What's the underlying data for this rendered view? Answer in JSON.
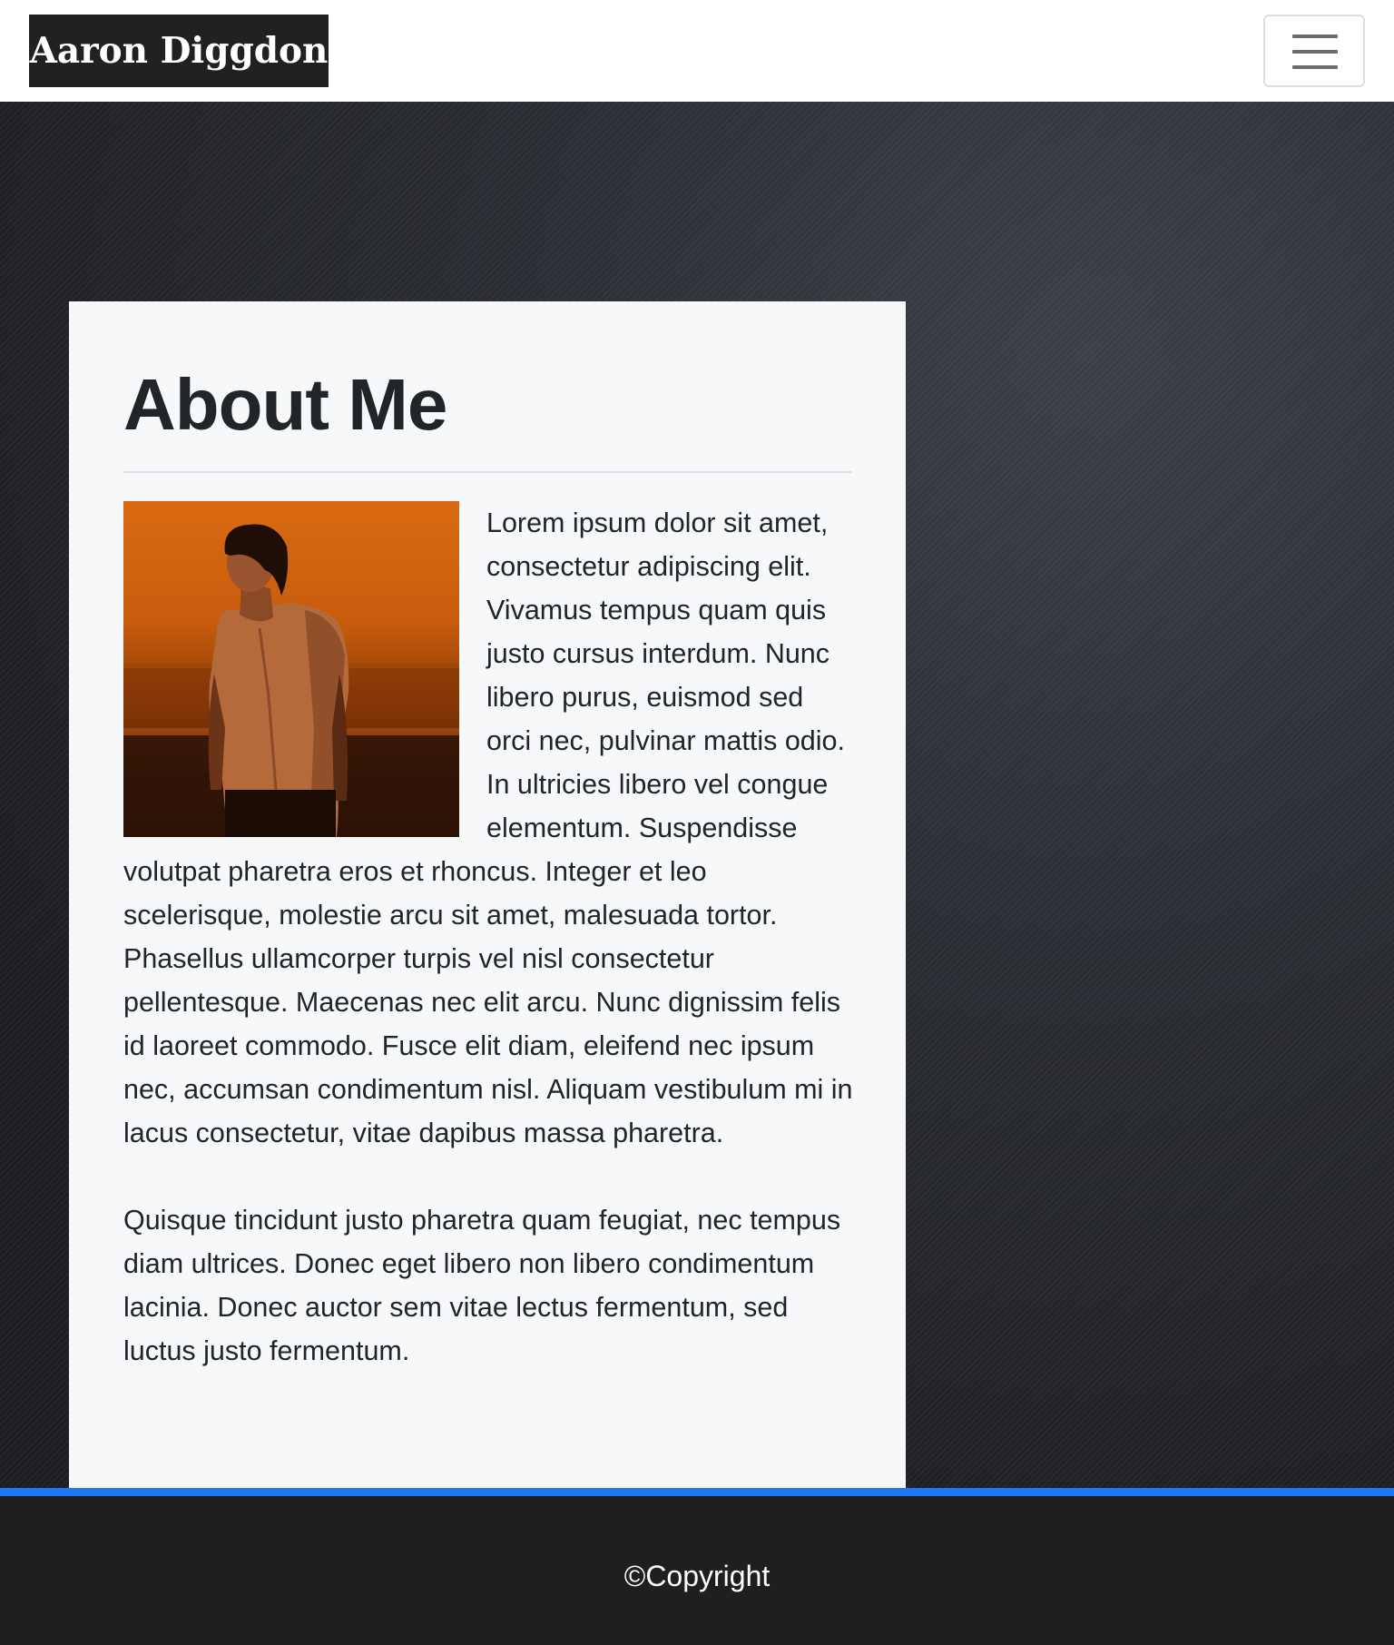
{
  "navbar": {
    "brand": "Aaron Diggdon",
    "toggle_icon": "hamburger-menu-icon"
  },
  "about": {
    "title": "About Me",
    "paragraphs": [
      "Lorem ipsum dolor sit amet, consectetur adipiscing elit. Vivamus tempus quam quis justo cursus interdum. Nunc libero purus, euismod sed orci nec, pulvinar mattis odio. In ultricies libero vel congue elementum. Suspendisse volutpat pharetra eros et rhoncus. Integer et leo scelerisque, molestie arcu sit amet, malesuada tortor. Phasellus ullamcorper turpis vel nisl consectetur pellentesque. Maecenas nec elit arcu. Nunc dignissim felis id laoreet commodo. Fusce elit diam, eleifend nec ipsum nec, accumsan condimentum nisl. Aliquam vestibulum mi in lacus consectetur, vitae dapibus massa pharetra.",
      "Quisque tincidunt justo pharetra quam feugiat, nec tempus diam ultrices. Donec eget libero non libero condimentum lacinia. Donec auctor sem vitae lectus fermentum, sed luctus justo fermentum."
    ]
  },
  "footer": {
    "copyright": "©Copyright"
  },
  "colors": {
    "accent_stripe": "#1b78f2",
    "brand_bg": "#212121",
    "card_bg": "#f7f8fa",
    "footer_bg": "#1e1f21"
  }
}
